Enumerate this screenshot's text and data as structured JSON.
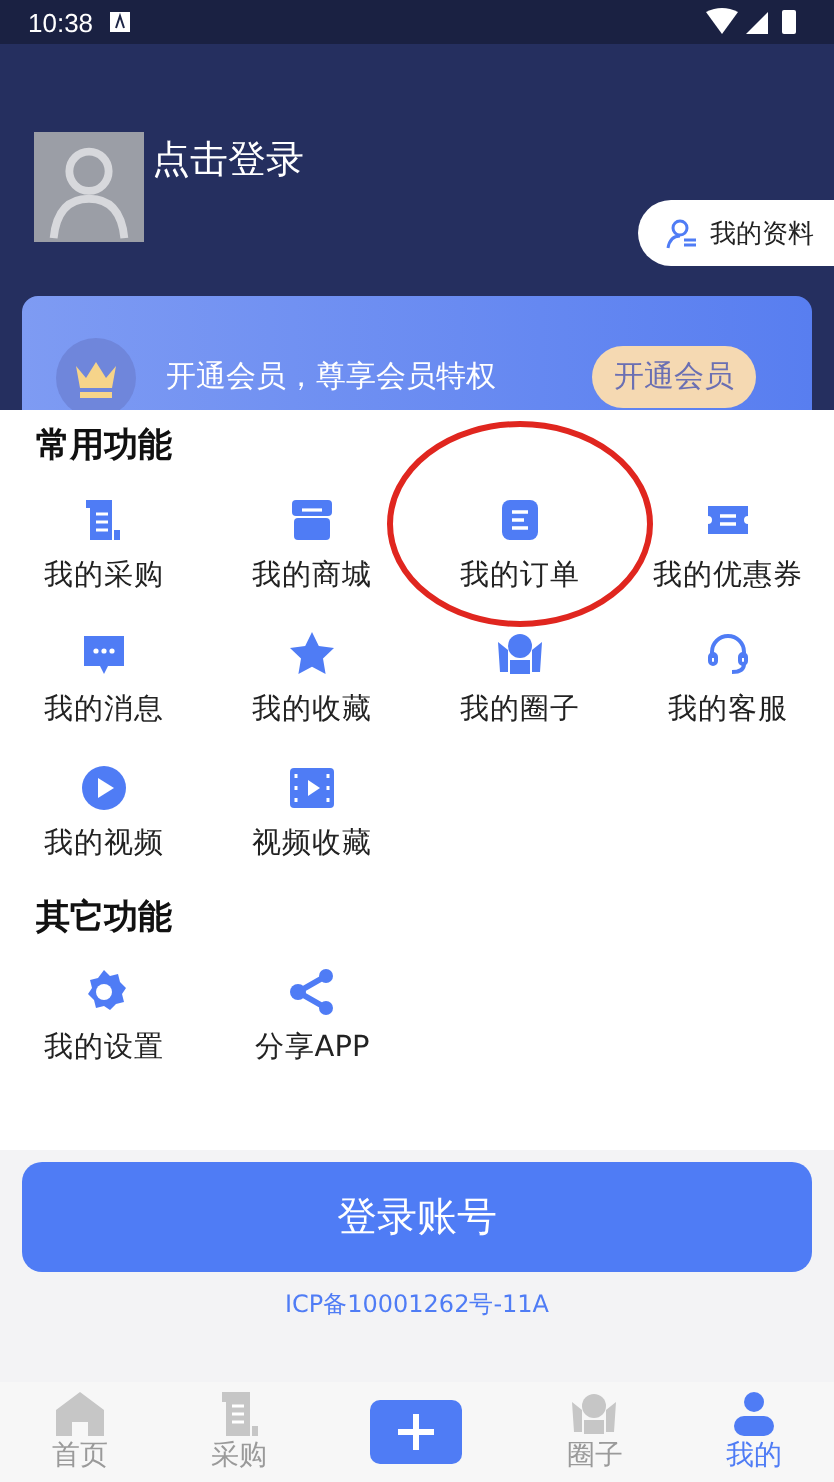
{
  "status_bar": {
    "time": "10:38"
  },
  "profile": {
    "login_prompt": "点击登录",
    "profile_button": "我的资料"
  },
  "membership": {
    "text": "开通会员，尊享会员特权",
    "button": "开通会员"
  },
  "sections": [
    {
      "title": "常用功能",
      "items": [
        {
          "label": "我的采购",
          "kind": "scroll",
          "highlighted": false
        },
        {
          "label": "我的商城",
          "kind": "shop",
          "highlighted": false
        },
        {
          "label": "我的订单",
          "kind": "order",
          "highlighted": true
        },
        {
          "label": "我的优惠券",
          "kind": "coupon",
          "highlighted": false
        },
        {
          "label": "我的消息",
          "kind": "message",
          "highlighted": false
        },
        {
          "label": "我的收藏",
          "kind": "star",
          "highlighted": false
        },
        {
          "label": "我的圈子",
          "kind": "people",
          "highlighted": false
        },
        {
          "label": "我的客服",
          "kind": "headset",
          "highlighted": false
        },
        {
          "label": "我的视频",
          "kind": "play",
          "highlighted": false
        },
        {
          "label": "视频收藏",
          "kind": "film",
          "highlighted": false
        }
      ]
    },
    {
      "title": "其它功能",
      "items": [
        {
          "label": "我的设置",
          "kind": "gear",
          "highlighted": false
        },
        {
          "label": "分享APP",
          "kind": "share",
          "highlighted": false
        }
      ]
    }
  ],
  "login_button": "登录账号",
  "icp": "ICP备10001262号-11A",
  "tab_bar": [
    {
      "label": "首页",
      "kind": "home",
      "selected": false
    },
    {
      "label": "采购",
      "kind": "scroll",
      "selected": false
    },
    {
      "kind": "plus",
      "selected": false
    },
    {
      "label": "圈子",
      "kind": "people",
      "selected": false
    },
    {
      "label": "我的",
      "kind": "person",
      "selected": true
    }
  ]
}
